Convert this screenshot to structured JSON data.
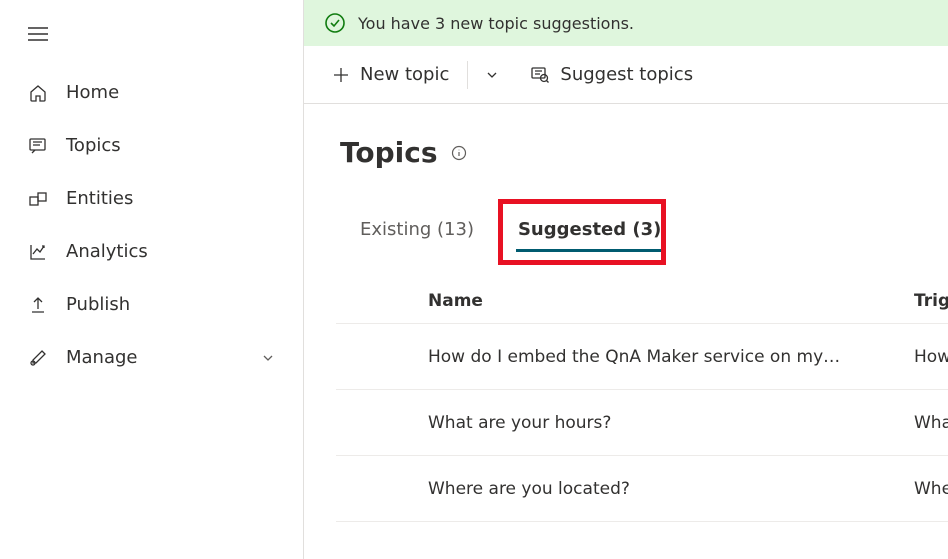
{
  "sidebar": {
    "items": [
      {
        "label": "Home",
        "icon": "home-icon"
      },
      {
        "label": "Topics",
        "icon": "topics-icon"
      },
      {
        "label": "Entities",
        "icon": "entities-icon"
      },
      {
        "label": "Analytics",
        "icon": "analytics-icon"
      },
      {
        "label": "Publish",
        "icon": "publish-icon"
      },
      {
        "label": "Manage",
        "icon": "manage-icon",
        "expandable": true
      }
    ]
  },
  "banner": {
    "message": "You have 3 new topic suggestions."
  },
  "toolbar": {
    "new_topic": "New topic",
    "suggest_topics": "Suggest topics"
  },
  "page": {
    "title": "Topics"
  },
  "tabs": {
    "existing": {
      "label": "Existing (13)",
      "count": 13,
      "active": false
    },
    "suggested": {
      "label": "Suggested (3)",
      "count": 3,
      "active": true
    }
  },
  "table": {
    "headers": {
      "name": "Name",
      "trigger": "Trigger phrases"
    },
    "rows": [
      {
        "name": "How do I embed the QnA Maker service on my…",
        "trigger": "How do I embed"
      },
      {
        "name": "What are your hours?",
        "trigger": "What are your hours"
      },
      {
        "name": "Where are you located?",
        "trigger": "Where are you located"
      }
    ]
  }
}
